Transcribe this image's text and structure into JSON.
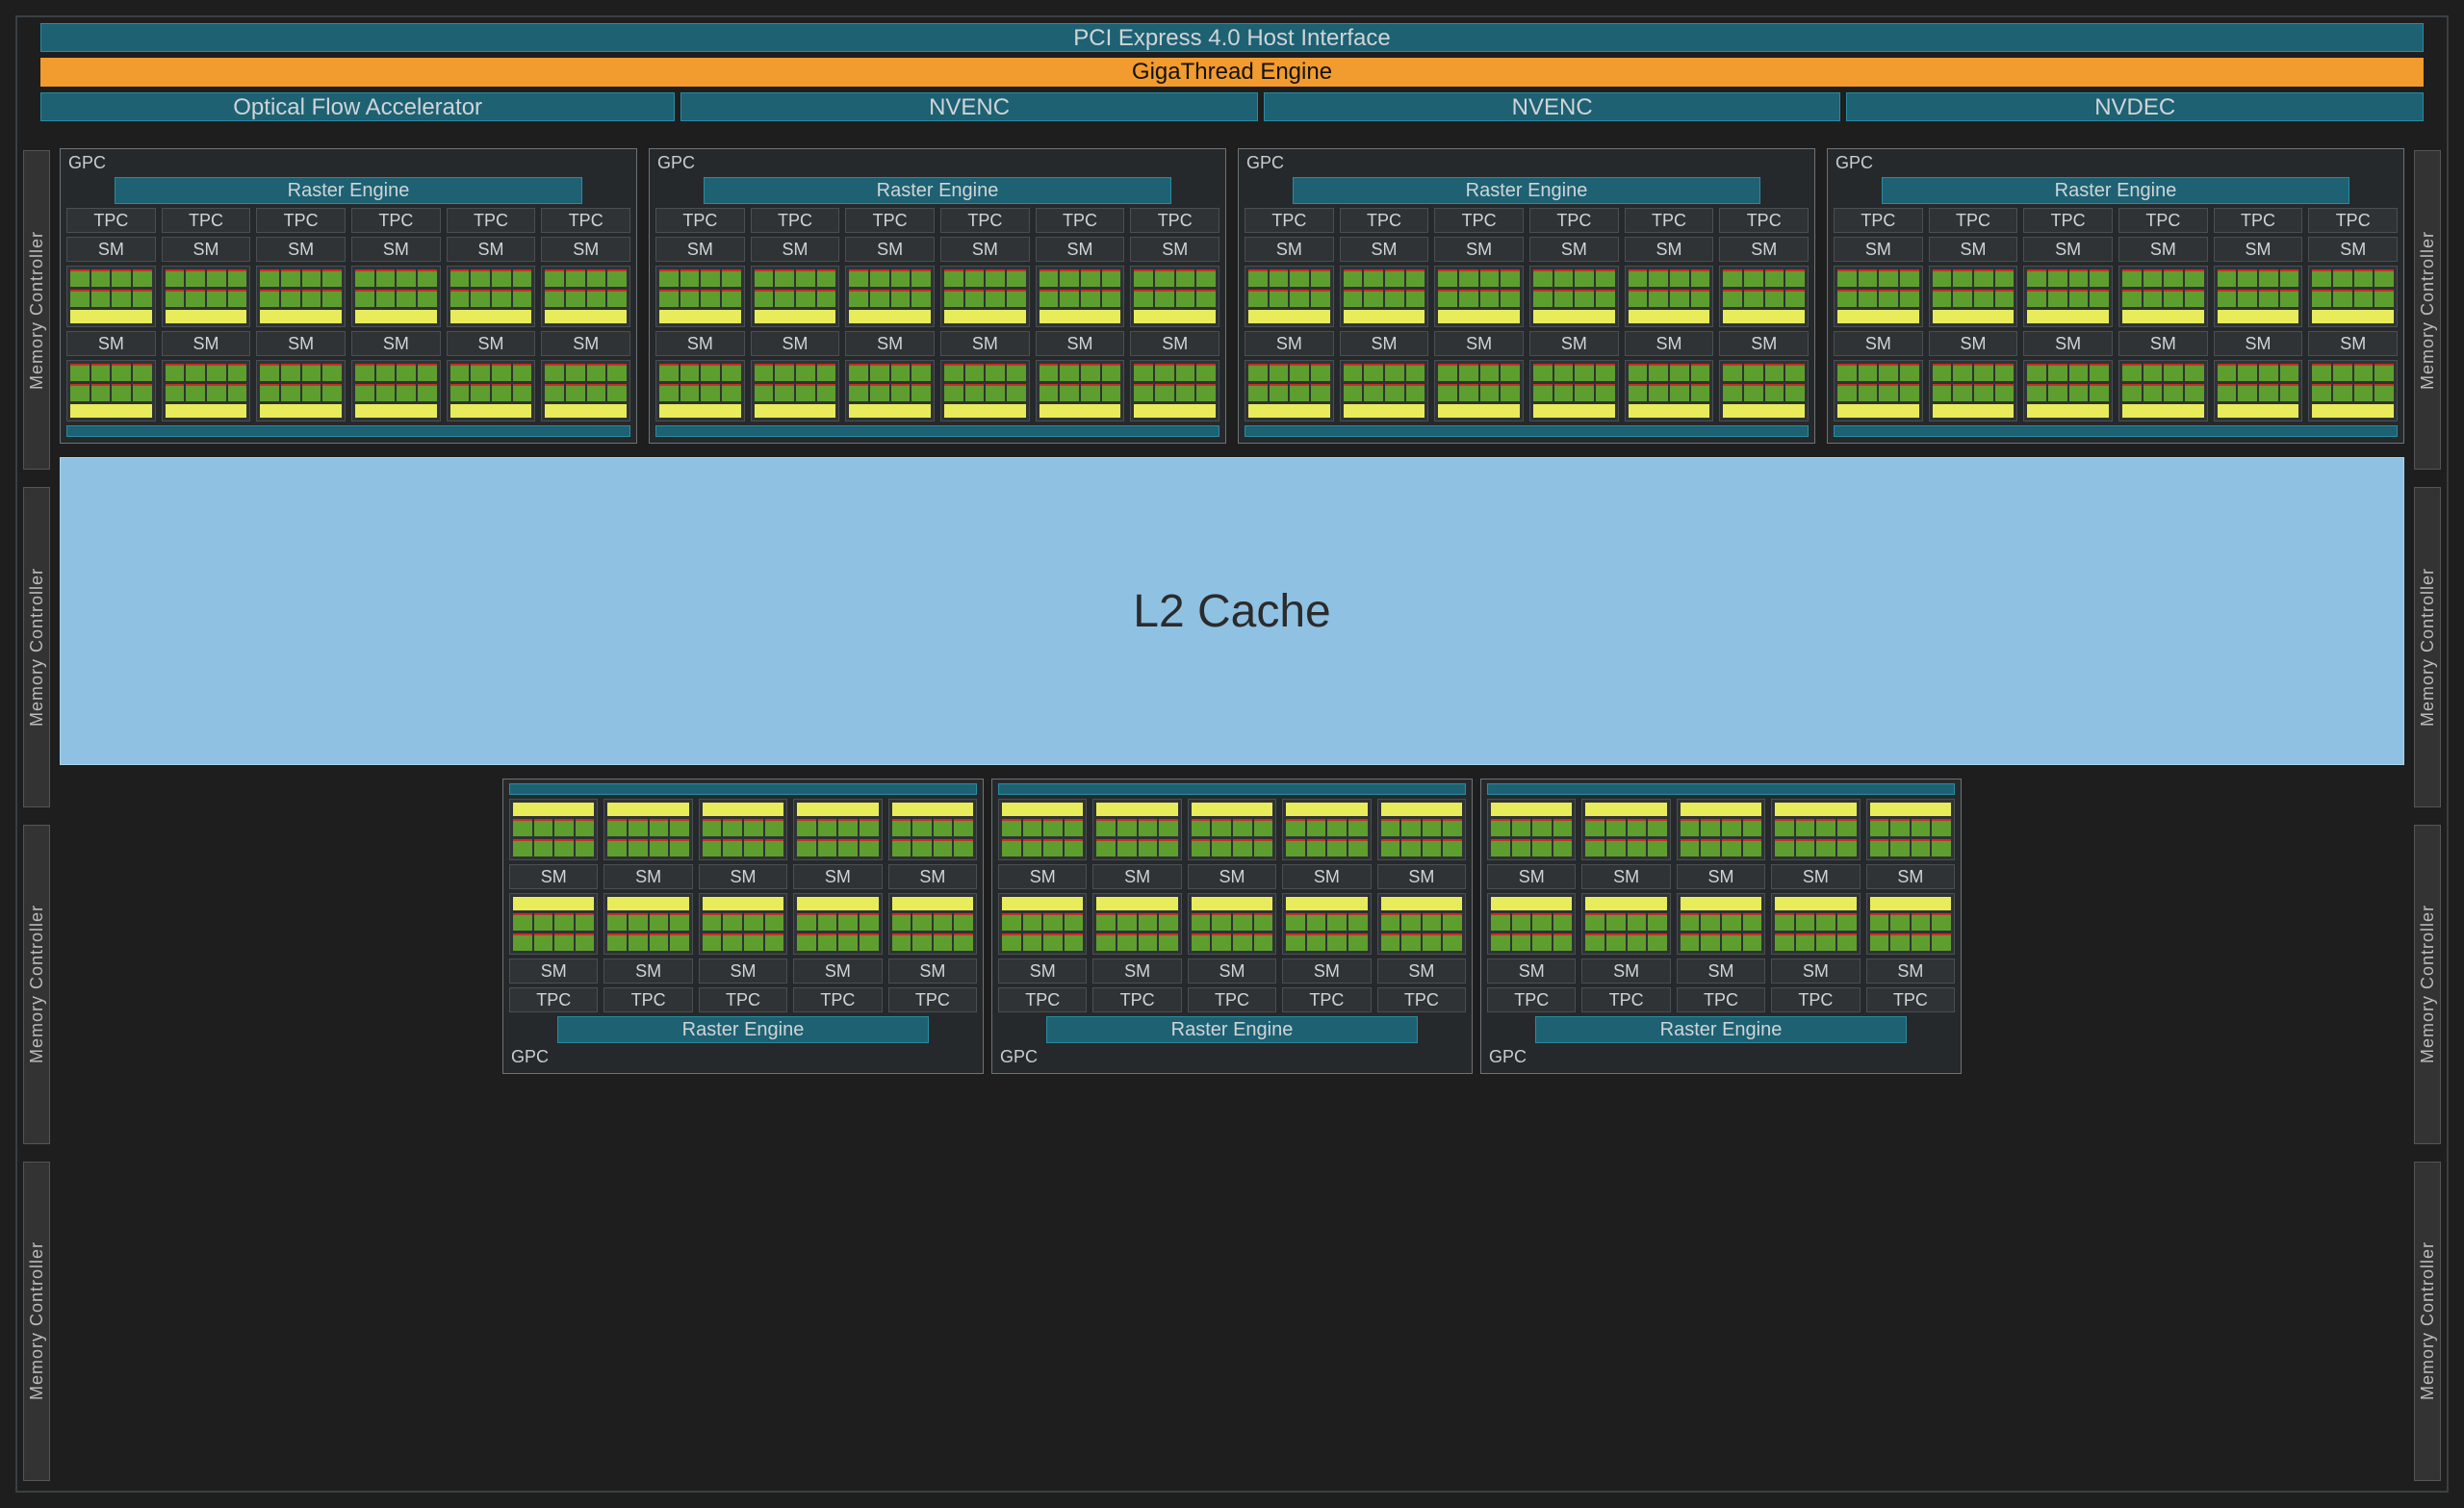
{
  "topbars": {
    "pci": "PCI Express 4.0 Host Interface",
    "giga": "GigaThread Engine",
    "ofa": "Optical Flow Accelerator",
    "enc1": "NVENC",
    "enc2": "NVENC",
    "dec": "NVDEC"
  },
  "mem_ctrl_label": "Memory Controller",
  "mem_ctrl_per_side": 4,
  "l2_label": "L2 Cache",
  "labels": {
    "gpc": "GPC",
    "raster": "Raster Engine",
    "tpc": "TPC",
    "sm": "SM"
  },
  "layout": {
    "top_gpc_count": 4,
    "bottom_gpc_count": 3,
    "tpc_per_top_gpc": 6,
    "tpc_per_bottom_gpc": 5,
    "sm_per_tpc": 2,
    "core_columns_per_sm": 4,
    "core_rows_per_sm": 2
  },
  "colors": {
    "bg": "#1e1e1e",
    "teal": "#1d6173",
    "orange": "#f29b2e",
    "l2": "#8fc1e3",
    "core_green": "#5e9e2e",
    "core_red_top": "#c7302b",
    "tensor_yellow": "#e8ec5b"
  }
}
